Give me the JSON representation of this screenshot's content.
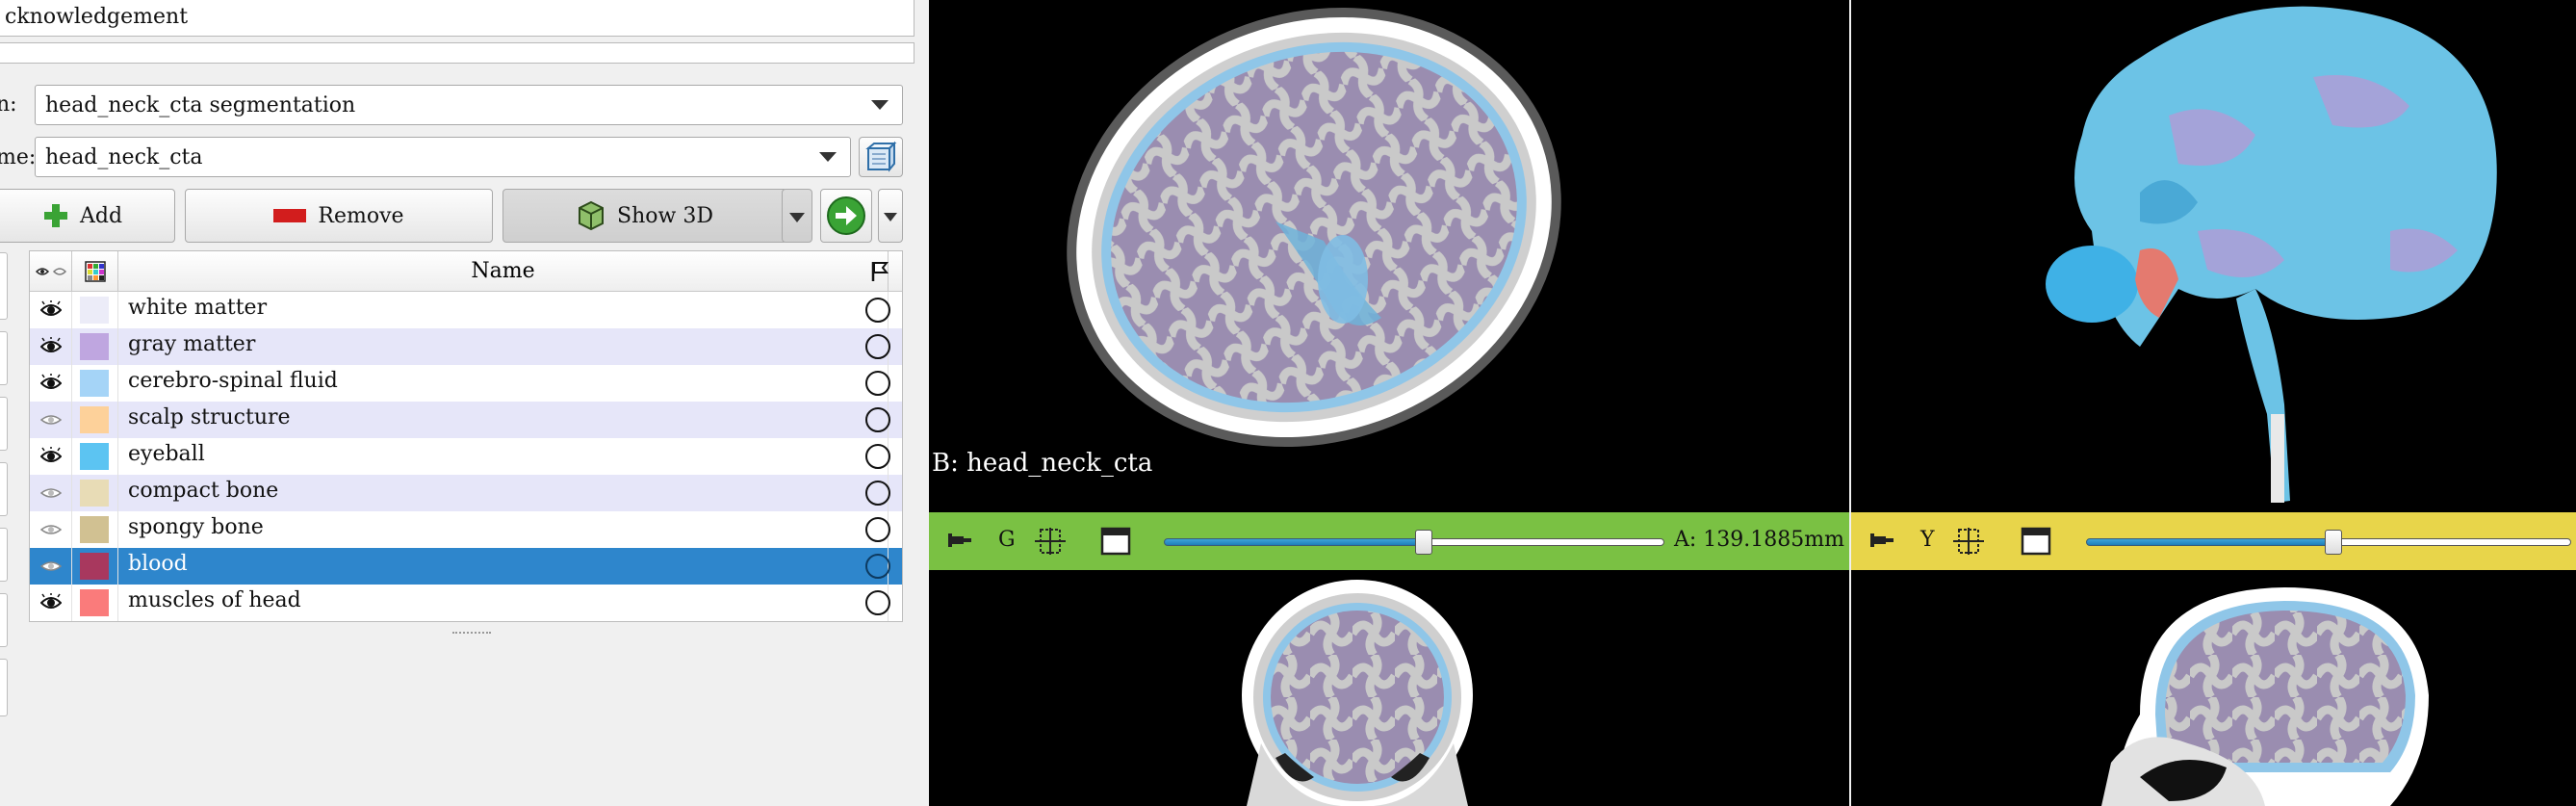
{
  "header": {
    "acknowledgement": "cknowledgement"
  },
  "segmentation_row": {
    "label": "n:",
    "value": "head_neck_cta segmentation"
  },
  "master_volume_row": {
    "label": "me:",
    "value": "head_neck_cta"
  },
  "toolbar": {
    "add_label": "Add",
    "remove_label": "Remove",
    "show3d_label": "Show 3D"
  },
  "table": {
    "header_name": "Name",
    "rows": [
      {
        "name": "white matter",
        "color": "#ececf8",
        "visible": true
      },
      {
        "name": "gray matter",
        "color": "#bfa6e0",
        "visible": true
      },
      {
        "name": "cerebro-spinal fluid",
        "color": "#a5d4f7",
        "visible": true
      },
      {
        "name": "scalp structure",
        "color": "#fdd19a",
        "visible": false
      },
      {
        "name": "eyeball",
        "color": "#5cc4f2",
        "visible": true
      },
      {
        "name": "compact bone",
        "color": "#e8dcb6",
        "visible": false
      },
      {
        "name": "spongy bone",
        "color": "#d1c192",
        "visible": false
      },
      {
        "name": "blood",
        "color": "#a8385e",
        "visible": false
      },
      {
        "name": "muscles of head",
        "color": "#fa7b7b",
        "visible": true
      }
    ]
  },
  "views": {
    "axial_label": "B: head_neck_cta",
    "green_bar": {
      "letter": "G",
      "offset": "A: 139.1885mm",
      "slider_fraction": 0.52
    },
    "yellow_bar": {
      "letter": "Y",
      "slider_fraction": 0.51
    }
  },
  "colors": {
    "selection": "#2e86cc",
    "green": "#7ac143",
    "yellow": "#e8d54a"
  }
}
